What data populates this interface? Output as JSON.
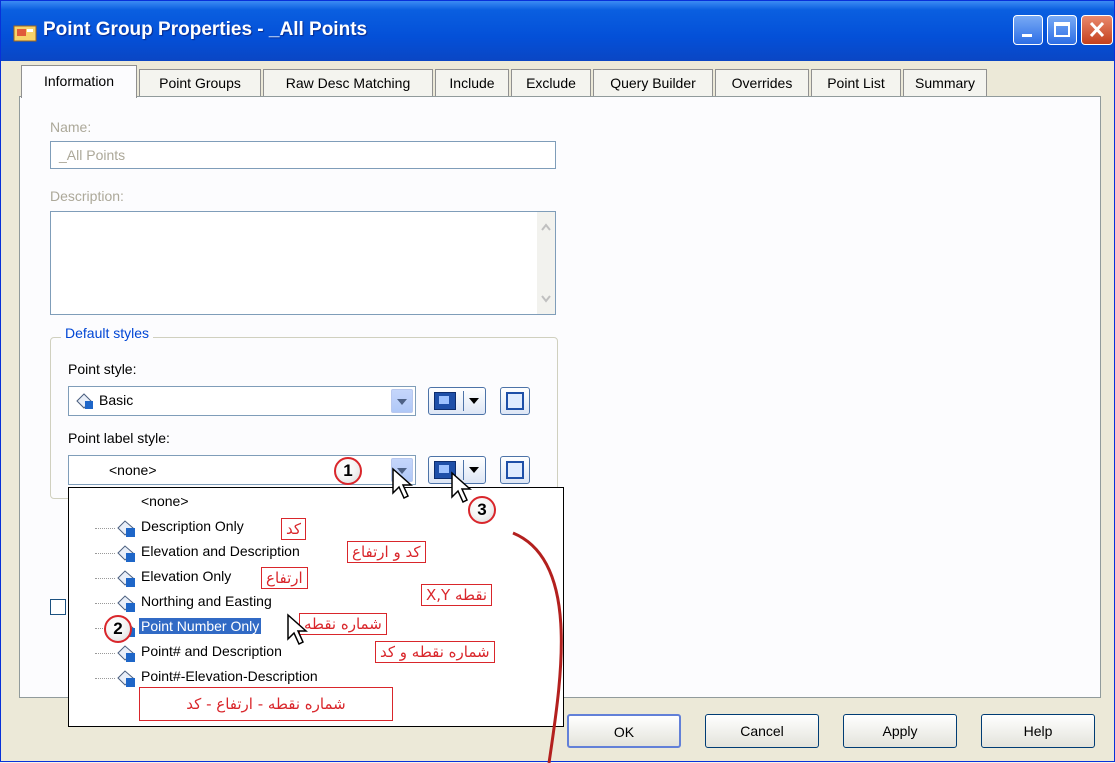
{
  "window": {
    "title": "Point Group Properties - _All Points"
  },
  "tabs": [
    {
      "label": "Information",
      "active": true
    },
    {
      "label": "Point Groups"
    },
    {
      "label": "Raw Desc Matching"
    },
    {
      "label": "Include"
    },
    {
      "label": "Exclude"
    },
    {
      "label": "Query Builder"
    },
    {
      "label": "Overrides"
    },
    {
      "label": "Point List"
    },
    {
      "label": "Summary"
    }
  ],
  "information": {
    "name_label": "Name:",
    "name_value": "_All Points",
    "description_label": "Description:",
    "description_value": "",
    "default_styles_title": "Default styles",
    "point_style_label": "Point style:",
    "point_style_value": "Basic",
    "point_label_style_label": "Point label style:",
    "point_label_style_value": "<none>"
  },
  "point_label_style_options": [
    {
      "label": "<none>",
      "icon": "none"
    },
    {
      "label": "Description Only",
      "icon": "label-style-icon"
    },
    {
      "label": "Elevation and Description",
      "icon": "label-style-icon"
    },
    {
      "label": "Elevation Only",
      "icon": "label-style-icon"
    },
    {
      "label": "Northing and Easting",
      "icon": "label-style-icon"
    },
    {
      "label": "Point Number Only",
      "icon": "label-style-icon",
      "highlighted": true
    },
    {
      "label": "Point# and Description",
      "icon": "label-style-icon"
    },
    {
      "label": "Point#-Elevation-Description",
      "icon": "label-style-icon"
    }
  ],
  "annotations": {
    "description_only": "کد",
    "elevation_and_description": "کد و ارتفاع",
    "elevation_only": "ارتفاع",
    "northing_easting": "X,Y نقطه",
    "point_number_only": "شماره نقطه",
    "point_and_description": "شماره نقطه و کد",
    "point_elev_desc": "شماره نقطه - ارتفاع - کد"
  },
  "step_badges": [
    "1",
    "2",
    "3"
  ],
  "buttons": {
    "ok": "OK",
    "cancel": "Cancel",
    "apply": "Apply",
    "help": "Help"
  },
  "colors": {
    "titlebar": "#0450d8",
    "selection": "#316ac5",
    "annotation": "#d9262b",
    "group_title": "#0046d5"
  }
}
